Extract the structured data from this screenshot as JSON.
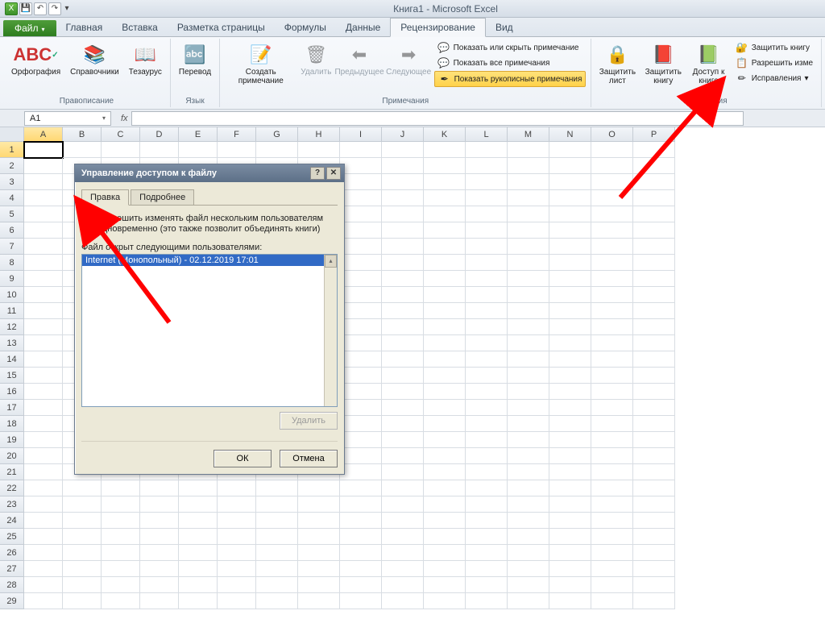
{
  "title": "Книга1 - Microsoft Excel",
  "qat": {
    "save": "💾",
    "undo": "↶",
    "redo": "↷"
  },
  "tabs": {
    "file": "Файл",
    "items": [
      "Главная",
      "Вставка",
      "Разметка страницы",
      "Формулы",
      "Данные",
      "Рецензирование",
      "Вид"
    ],
    "active_index": 5
  },
  "ribbon": {
    "group_proofing": "Правописание",
    "group_lang": "Язык",
    "group_comments": "Примечания",
    "group_changes": "Изменения",
    "spelling": "Орфография",
    "research": "Справочники",
    "thesaurus": "Тезаурус",
    "translate": "Перевод",
    "new_comment": "Создать примечание",
    "delete": "Удалить",
    "prev": "Предыдущее",
    "next": "Следующее",
    "show_hide": "Показать или скрыть примечание",
    "show_all": "Показать все примечания",
    "show_ink": "Показать рукописные примечания",
    "protect_sheet": "Защитить лист",
    "protect_book": "Защитить книгу",
    "share_book": "Доступ к книге",
    "protect_share": "Защитить книгу",
    "allow_ranges": "Разрешить изме",
    "track": "Исправления"
  },
  "namebox": "A1",
  "columns": [
    "A",
    "B",
    "C",
    "D",
    "E",
    "F",
    "G",
    "H",
    "I",
    "J",
    "K",
    "L",
    "M",
    "N",
    "O",
    "P"
  ],
  "rows_count": 29,
  "dialog": {
    "title": "Управление доступом к файлу",
    "tab_edit": "Правка",
    "tab_details": "Подробнее",
    "checkbox": "Разрешить изменять файл нескольким пользователям одновременно (это также позволит объединять книги)",
    "list_label": "Файл открыт следующими пользователями:",
    "user": "Internet (Монопольный) - 02.12.2019 17:01",
    "delete_btn": "Удалить",
    "ok": "ОК",
    "cancel": "Отмена"
  }
}
